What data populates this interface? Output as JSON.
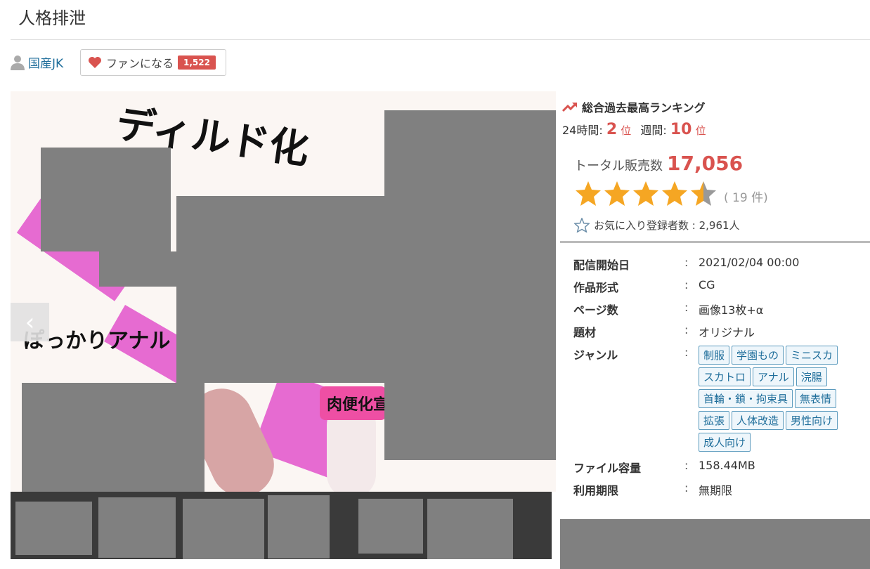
{
  "title": "人格排泄",
  "author": {
    "name": "国産JK",
    "icon": "user-icon"
  },
  "fan_button": {
    "label": "ファンになる",
    "count": "1,522",
    "icon": "heart-icon"
  },
  "gallery": {
    "art_text": {
      "top": "ディルド化",
      "left": "ぽっかりアナル",
      "band": "肉便化宣"
    },
    "prev_icon": "chevron-left-icon",
    "prev_glyph": "‹"
  },
  "ranking": {
    "heading": "総合過去最高ランキング",
    "icon": "trend-up-icon",
    "h24_label": "24時間:",
    "h24_rank": "2",
    "h24_unit": "位",
    "week_label": "週間:",
    "week_rank": "10",
    "week_unit": "位"
  },
  "sales": {
    "label": "トータル販売数",
    "value": "17,056"
  },
  "rating": {
    "stars": 4.5,
    "max": 5,
    "count_text": "( 19 件)",
    "color": "#f5a623"
  },
  "favorites": {
    "text": "お気に入り登録者数 : 2,961人",
    "icon": "star-outline-icon"
  },
  "details": {
    "release_label": "配信開始日",
    "release_value": "2021/02/04 00:00",
    "format_label": "作品形式",
    "format_value": "CG",
    "pages_label": "ページ数",
    "pages_value": "画像13枚+α",
    "theme_label": "題材",
    "theme_value": "オリジナル",
    "genre_label": "ジャンル",
    "genres": [
      "制服",
      "学園もの",
      "ミニスカ",
      "スカトロ",
      "アナル",
      "浣腸",
      "首輪・鎖・拘束具",
      "無表情",
      "拡張",
      "人体改造",
      "男性向け",
      "成人向け"
    ],
    "size_label": "ファイル容量",
    "size_value": "158.44MB",
    "limit_label": "利用期限",
    "limit_value": "無期限",
    "colon": ":"
  },
  "colors": {
    "accent": "#d9534f",
    "link": "#1f6e9b",
    "tag_border": "#5a9abd"
  }
}
